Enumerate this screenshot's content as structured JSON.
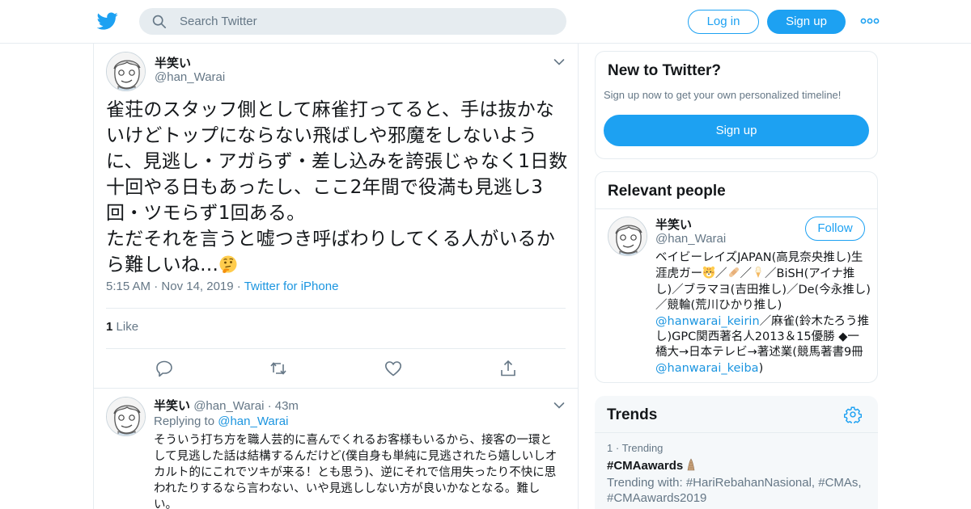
{
  "header": {
    "search_placeholder": "Search Twitter",
    "login_label": "Log in",
    "signup_label": "Sign up",
    "more_icon": "more-dots-icon"
  },
  "tweet": {
    "author_name": "半笑い",
    "author_handle": "@han_Warai",
    "text": "雀荘のスタッフ側として麻雀打ってると、手は抜かないけどトップにならない飛ばしや邪魔をしないように、見逃し・アガらず・差し込みを誇張じゃなく1日数十回やる日もあったし、ここ2年間で役満も見逃し3回・ツモらず1回ある。\nただそれを言うと嘘つき呼ばわりしてくる人がいるから難しいね…",
    "time": "5:15 AM",
    "date": "Nov 14, 2019",
    "source": "Twitter for iPhone",
    "like_count": "1",
    "like_label": "Like"
  },
  "reply": {
    "author_name": "半笑い",
    "author_handle": "@han_Warai",
    "age": "43m",
    "replying_to_label": "Replying to",
    "replying_to_handle": "@han_Warai",
    "text": "そういう打ち方を職人芸的に喜んでくれるお客様もいるから、接客の一環として見逃した話は結構するんだけど(僕自身も単純に見逃されたら嬉しいしオカルト的にこれでツキが来る！とも思う)、逆にそれで信用失ったり不快に思われたりするなら言わない、いや見逃ししない方が良いかなとなる。難しい。"
  },
  "new_to_twitter": {
    "title": "New to Twitter?",
    "subtitle": "Sign up now to get your own personalized timeline!",
    "signup_label": "Sign up"
  },
  "relevant_people": {
    "title": "Relevant people",
    "name": "半笑い",
    "handle": "@han_Warai",
    "follow_label": "Follow",
    "bio_1": "ベイビーレイズJAPAN(高見奈央推し)生涯虎ガー",
    "bio_2": "／",
    "bio_3": "／",
    "bio_4": "／BiSH(アイナ推し)／ブラマヨ(吉田推し)／De(今永推し)／競輪(荒川ひかり推し)",
    "bio_link_1": "@hanwarai_keirin",
    "bio_5": "／麻雀(鈴木たろう推し)GPC関西著名人2013＆15優勝 ◆一橋大→日本テレビ→著述業(競馬著書9冊",
    "bio_link_2": "@hanwarai_keiba",
    "bio_6": ")"
  },
  "trends": {
    "title": "Trends",
    "items": [
      {
        "rank": "1",
        "label": "Trending",
        "hashtag": "#CMAawards",
        "with_label": "Trending with:",
        "with_tags": "#HariRebahanNasional, #CMAs, #CMAawards2019"
      }
    ]
  },
  "colors": {
    "brand_blue": "#1da1f2",
    "link_blue": "#1b95e0",
    "secondary_text": "#657786",
    "border": "#e6ecf0"
  }
}
